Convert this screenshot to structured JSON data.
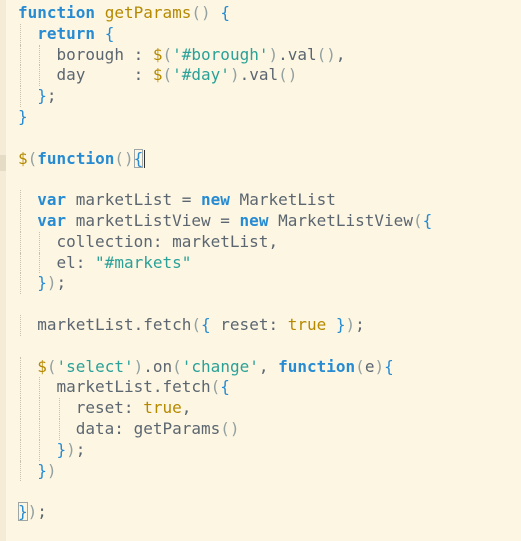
{
  "editor": {
    "lines": [
      {
        "indent": 0,
        "tokens": [
          {
            "t": "kw",
            "v": "function"
          },
          {
            "t": "txt",
            "v": " "
          },
          {
            "t": "fn",
            "v": "getParams"
          },
          {
            "t": "punc",
            "v": "()"
          },
          {
            "t": "txt",
            "v": " "
          },
          {
            "t": "brace",
            "v": "{"
          }
        ]
      },
      {
        "indent": 1,
        "tokens": [
          {
            "t": "kw",
            "v": "return"
          },
          {
            "t": "txt",
            "v": " "
          },
          {
            "t": "brace",
            "v": "{"
          }
        ]
      },
      {
        "indent": 2,
        "tokens": [
          {
            "t": "txt",
            "v": "borough"
          },
          {
            "t": "txt",
            "v": " : "
          },
          {
            "t": "fn",
            "v": "$"
          },
          {
            "t": "punc",
            "v": "("
          },
          {
            "t": "str",
            "v": "'#borough'"
          },
          {
            "t": "punc",
            "v": ")"
          },
          {
            "t": "txt",
            "v": "."
          },
          {
            "t": "txt",
            "v": "val"
          },
          {
            "t": "punc",
            "v": "()"
          },
          {
            "t": "txt",
            "v": ","
          }
        ]
      },
      {
        "indent": 2,
        "tokens": [
          {
            "t": "txt",
            "v": "day"
          },
          {
            "t": "txt",
            "v": "     : "
          },
          {
            "t": "fn",
            "v": "$"
          },
          {
            "t": "punc",
            "v": "("
          },
          {
            "t": "str",
            "v": "'#day'"
          },
          {
            "t": "punc",
            "v": ")"
          },
          {
            "t": "txt",
            "v": "."
          },
          {
            "t": "txt",
            "v": "val"
          },
          {
            "t": "punc",
            "v": "()"
          }
        ]
      },
      {
        "indent": 1,
        "tokens": [
          {
            "t": "brace",
            "v": "}"
          },
          {
            "t": "txt",
            "v": ";"
          }
        ]
      },
      {
        "indent": 0,
        "tokens": [
          {
            "t": "brace",
            "v": "}"
          }
        ]
      },
      {
        "indent": 0,
        "tokens": []
      },
      {
        "indent": 0,
        "tokens": [
          {
            "t": "fn",
            "v": "$"
          },
          {
            "t": "punc",
            "v": "("
          },
          {
            "t": "kw",
            "v": "function"
          },
          {
            "t": "punc",
            "v": "()"
          },
          {
            "t": "brace-box",
            "v": "{"
          },
          {
            "t": "caret",
            "v": ""
          }
        ]
      },
      {
        "indent": 0,
        "tokens": []
      },
      {
        "indent": 1,
        "tokens": [
          {
            "t": "kw",
            "v": "var"
          },
          {
            "t": "txt",
            "v": " marketList = "
          },
          {
            "t": "kw",
            "v": "new"
          },
          {
            "t": "txt",
            "v": " MarketList"
          }
        ]
      },
      {
        "indent": 1,
        "tokens": [
          {
            "t": "kw",
            "v": "var"
          },
          {
            "t": "txt",
            "v": " marketListView = "
          },
          {
            "t": "kw",
            "v": "new"
          },
          {
            "t": "txt",
            "v": " MarketListView"
          },
          {
            "t": "punc",
            "v": "("
          },
          {
            "t": "brace",
            "v": "{"
          }
        ]
      },
      {
        "indent": 2,
        "tokens": [
          {
            "t": "txt",
            "v": "collection: marketList,"
          }
        ]
      },
      {
        "indent": 2,
        "tokens": [
          {
            "t": "txt",
            "v": "el: "
          },
          {
            "t": "str",
            "v": "\"#markets\""
          }
        ]
      },
      {
        "indent": 1,
        "tokens": [
          {
            "t": "brace",
            "v": "}"
          },
          {
            "t": "punc",
            "v": ")"
          },
          {
            "t": "txt",
            "v": ";"
          }
        ]
      },
      {
        "indent": 0,
        "tokens": []
      },
      {
        "indent": 1,
        "tokens": [
          {
            "t": "txt",
            "v": "marketList.fetch"
          },
          {
            "t": "punc",
            "v": "("
          },
          {
            "t": "brace",
            "v": "{"
          },
          {
            "t": "txt",
            "v": " reset: "
          },
          {
            "t": "fn",
            "v": "true"
          },
          {
            "t": "txt",
            "v": " "
          },
          {
            "t": "brace",
            "v": "}"
          },
          {
            "t": "punc",
            "v": ")"
          },
          {
            "t": "txt",
            "v": ";"
          }
        ]
      },
      {
        "indent": 0,
        "tokens": []
      },
      {
        "indent": 1,
        "tokens": [
          {
            "t": "fn",
            "v": "$"
          },
          {
            "t": "punc",
            "v": "("
          },
          {
            "t": "str",
            "v": "'select'"
          },
          {
            "t": "punc",
            "v": ")"
          },
          {
            "t": "txt",
            "v": ".on"
          },
          {
            "t": "punc",
            "v": "("
          },
          {
            "t": "str",
            "v": "'change'"
          },
          {
            "t": "txt",
            "v": ", "
          },
          {
            "t": "kw",
            "v": "function"
          },
          {
            "t": "punc",
            "v": "("
          },
          {
            "t": "txt",
            "v": "e"
          },
          {
            "t": "punc",
            "v": ")"
          },
          {
            "t": "brace",
            "v": "{"
          }
        ]
      },
      {
        "indent": 2,
        "tokens": [
          {
            "t": "txt",
            "v": "marketList.fetch"
          },
          {
            "t": "punc",
            "v": "("
          },
          {
            "t": "brace",
            "v": "{"
          }
        ]
      },
      {
        "indent": 3,
        "tokens": [
          {
            "t": "txt",
            "v": "reset: "
          },
          {
            "t": "fn",
            "v": "true"
          },
          {
            "t": "txt",
            "v": ","
          }
        ]
      },
      {
        "indent": 3,
        "tokens": [
          {
            "t": "txt",
            "v": "data: getParams"
          },
          {
            "t": "punc",
            "v": "()"
          }
        ]
      },
      {
        "indent": 2,
        "tokens": [
          {
            "t": "brace",
            "v": "}"
          },
          {
            "t": "punc",
            "v": ")"
          },
          {
            "t": "txt",
            "v": ";"
          }
        ]
      },
      {
        "indent": 1,
        "tokens": [
          {
            "t": "brace",
            "v": "}"
          },
          {
            "t": "punc",
            "v": ")"
          }
        ]
      },
      {
        "indent": 0,
        "tokens": []
      },
      {
        "indent": 0,
        "tokens": [
          {
            "t": "brace-box",
            "v": "}"
          },
          {
            "t": "punc",
            "v": ")"
          },
          {
            "t": "txt",
            "v": ";"
          }
        ]
      }
    ]
  }
}
